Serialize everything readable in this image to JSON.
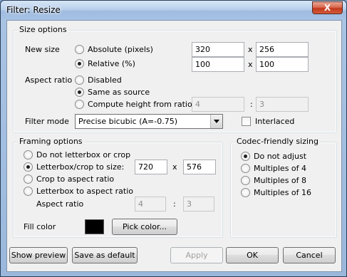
{
  "window": {
    "title": "Filter: Resize",
    "close_glyph": "X"
  },
  "size_options": {
    "title": "Size options",
    "new_size_label": "New size",
    "absolute_label": "Absolute (pixels)",
    "relative_label": "Relative (%)",
    "mode_selected": "relative",
    "abs_width": "320",
    "abs_height": "256",
    "rel_width": "100",
    "rel_height": "100",
    "times": "x",
    "aspect_label": "Aspect ratio",
    "aspect_disabled": "Disabled",
    "aspect_same": "Same as source",
    "aspect_compute": "Compute height from ratio:",
    "aspect_selected": "same",
    "ratio_a": "4",
    "ratio_b": "3",
    "ratio_sep": ":",
    "filter_mode_label": "Filter mode",
    "filter_mode_value": "Precise bicubic (A=-0.75)",
    "interlaced_label": "Interlaced",
    "interlaced_checked": false
  },
  "framing": {
    "title": "Framing options",
    "opt_none": "Do not letterbox or crop",
    "opt_letterbox": "Letterbox/crop to size:",
    "opt_crop": "Crop to aspect ratio",
    "opt_letterbox_aspect": "Letterbox to aspect ratio",
    "selected": "letterbox",
    "width": "720",
    "height": "576",
    "times": "x",
    "aspect_label": "Aspect ratio",
    "ratio_a": "4",
    "ratio_b": "3",
    "ratio_sep": ":",
    "fill_color_label": "Fill color",
    "fill_color": "#000000",
    "pick_color_button": "Pick color..."
  },
  "codec": {
    "title": "Codec-friendly sizing",
    "opt_none": "Do not adjust",
    "opt_4": "Multiples of 4",
    "opt_8": "Multiples of 8",
    "opt_16": "Multiples of 16",
    "selected": "none"
  },
  "buttons": {
    "show_preview": "Show preview",
    "save_default": "Save as default",
    "apply": "Apply",
    "ok": "OK",
    "cancel": "Cancel"
  }
}
